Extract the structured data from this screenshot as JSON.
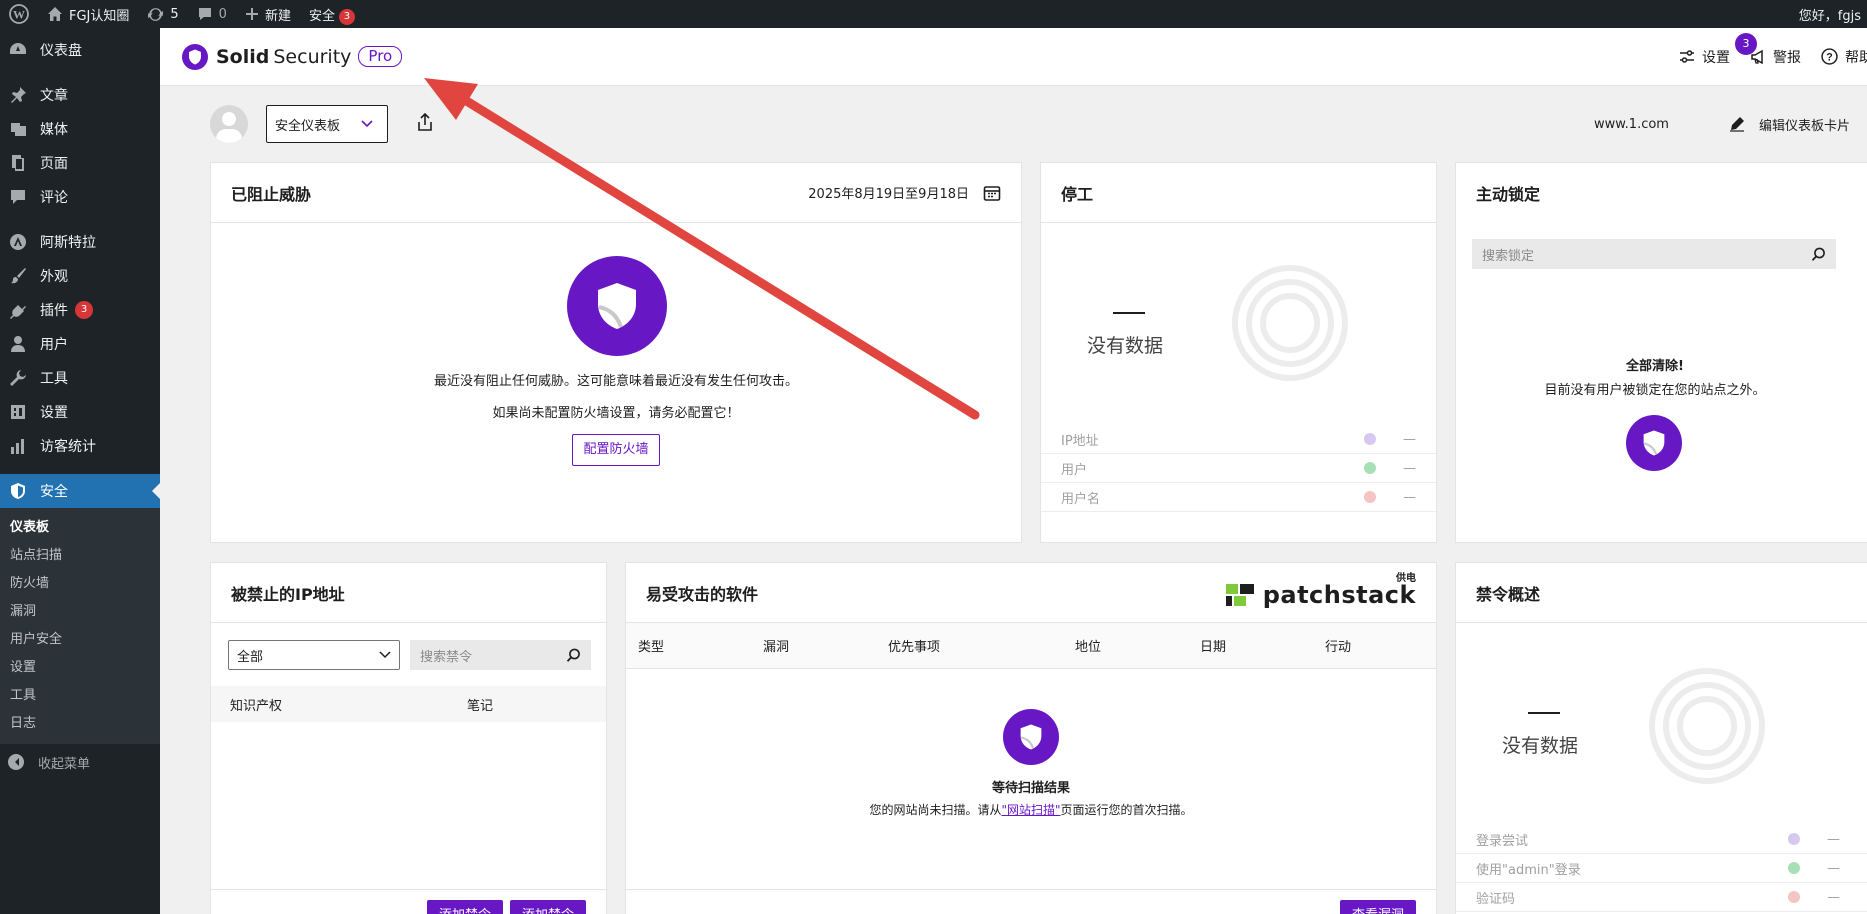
{
  "admin_bar": {
    "site_name": "FGJ认知圈",
    "updates_count": "5",
    "comments_count": "0",
    "new_label": "新建",
    "security_label": "安全",
    "security_badge": "3",
    "greeting": "您好，fgjs"
  },
  "sidebar": {
    "items": [
      {
        "label": "仪表盘",
        "icon": "dashboard-icon"
      },
      {
        "label": "文章",
        "icon": "pin-icon"
      },
      {
        "label": "媒体",
        "icon": "media-icon"
      },
      {
        "label": "页面",
        "icon": "page-icon"
      },
      {
        "label": "评论",
        "icon": "comment-icon"
      },
      {
        "label": "阿斯特拉",
        "icon": "astra-icon"
      },
      {
        "label": "外观",
        "icon": "brush-icon"
      },
      {
        "label": "插件",
        "icon": "plugin-icon",
        "badge": "3"
      },
      {
        "label": "用户",
        "icon": "user-icon"
      },
      {
        "label": "工具",
        "icon": "wrench-icon"
      },
      {
        "label": "设置",
        "icon": "settings-icon"
      },
      {
        "label": "访客统计",
        "icon": "chart-icon"
      }
    ],
    "active_item": {
      "label": "安全",
      "icon": "shield-icon"
    },
    "submenu": [
      "仪表板",
      "站点扫描",
      "防火墙",
      "漏洞",
      "用户安全",
      "设置",
      "工具",
      "日志"
    ],
    "collapse_label": "收起菜单"
  },
  "header": {
    "logo_solid": "Solid",
    "logo_security": "Security",
    "logo_pro": "Pro",
    "settings_label": "设置",
    "alerts_badge": "3",
    "alerts_label": "警报",
    "help_label": "帮助"
  },
  "toolbar": {
    "dashboard_select": "安全仪表板",
    "site": "www.1.com",
    "edit_cards_label": "编辑仪表板卡片"
  },
  "threats_card": {
    "title": "已阻止威胁",
    "date_range": "2025年8月19日至9月18日",
    "message_1": "最近没有阻止任何威胁。这可能意味着最近没有发生任何攻击。",
    "message_2": "如果尚未配置防火墙设置，请务必配置它！",
    "button": "配置防火墙"
  },
  "downtime_card": {
    "title": "停工",
    "no_data": "没有数据",
    "legend": [
      {
        "label": "IP地址",
        "color": "#d7c8f0",
        "value": "—"
      },
      {
        "label": "用户",
        "color": "#a8e0b5",
        "value": "—"
      },
      {
        "label": "用户名",
        "color": "#f5c4c4",
        "value": "—"
      }
    ]
  },
  "lockouts_card": {
    "title": "主动锁定",
    "search_placeholder": "搜索锁定",
    "clear_title": "全部清除!",
    "clear_text": "目前没有用户被锁定在您的站点之外。"
  },
  "banned_ips_card": {
    "title": "被禁止的IP地址",
    "filter_value": "全部",
    "search_placeholder": "搜索禁令",
    "columns": [
      "知识产权",
      "笔记"
    ],
    "btn_1": "添加禁令",
    "btn_2": "添加禁令"
  },
  "vulnerable_card": {
    "title": "易受攻击的软件",
    "powered_by": "供电",
    "brand": "patchstack",
    "columns": [
      "类型",
      "漏洞",
      "优先事项",
      "地位",
      "日期",
      "行动"
    ],
    "waiting_title": "等待扫描结果",
    "waiting_text_1": "您的网站尚未扫描。请从",
    "waiting_link": "\"网站扫描\"",
    "waiting_text_2": "页面运行您的首次扫描。",
    "view_btn": "查看漏洞"
  },
  "bans_overview_card": {
    "title": "禁令概述",
    "no_data": "没有数据",
    "legend": [
      {
        "label": "登录尝试",
        "color": "#d7c8f0",
        "value": "—"
      },
      {
        "label": "使用\"admin\"登录",
        "color": "#a8e0b5",
        "value": "—"
      },
      {
        "label": "验证码",
        "color": "#f5c4c4",
        "value": "—"
      }
    ]
  },
  "colors": {
    "brand_purple": "#6817c5",
    "wp_blue": "#2271b1",
    "annotation_arrow": "#e0463f"
  }
}
